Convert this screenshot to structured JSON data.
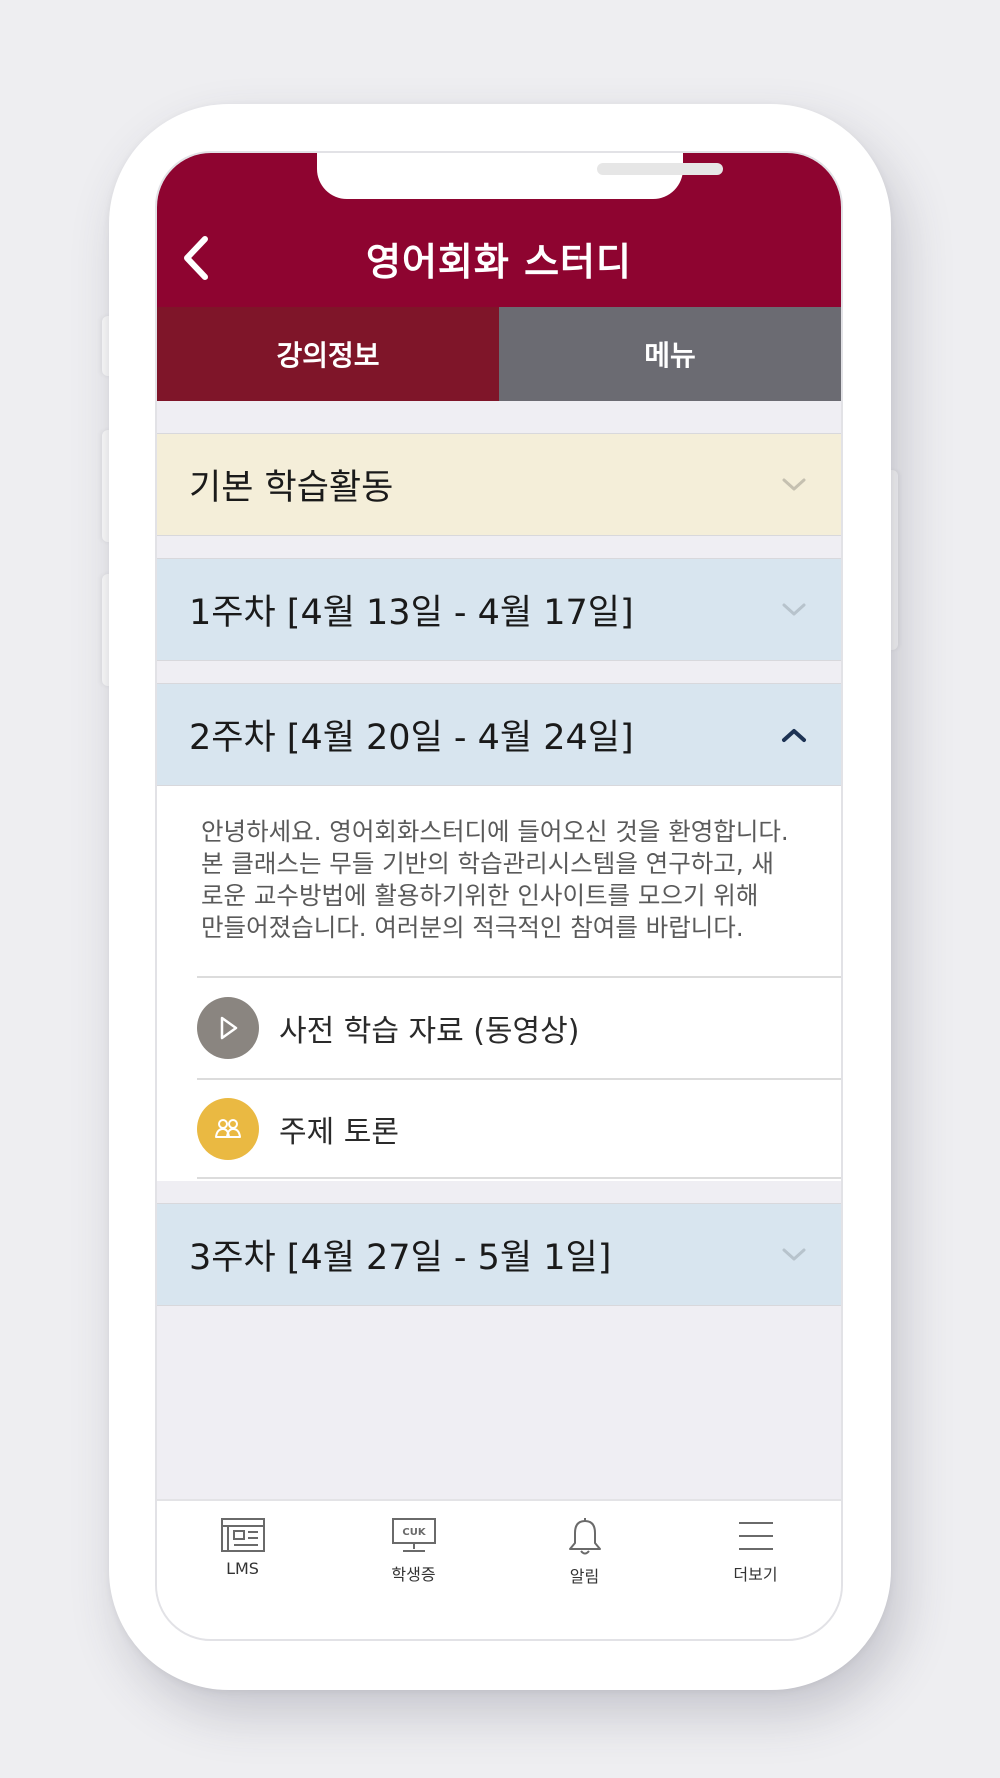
{
  "header": {
    "title": "영어회화 스터디",
    "back_icon": "chevron-left-icon"
  },
  "tabs": [
    {
      "label": "강의정보",
      "active": true
    },
    {
      "label": "메뉴",
      "active": false
    }
  ],
  "sections": {
    "basic": {
      "label": "기본 학습활동"
    },
    "week1": {
      "label": "1주차 [4월 13일 - 4월 17일]"
    },
    "week2": {
      "label": "2주차 [4월 20일 - 4월 24일]",
      "description_lines": [
        "안녕하세요. 영어회화스터디에 들어오신 것을 환영합니다.",
        "본 클래스는 무들 기반의 학습관리시스템을 연구하고, 새",
        "로운 교수방법에 활용하기위한 인사이트를 모으기 위해",
        "만들어졌습니다. 여러분의 적극적인 참여를 바랍니다."
      ],
      "items": [
        {
          "label": "사전 학습 자료 (동영상)",
          "icon": "play-icon",
          "color": "#8a8580"
        },
        {
          "label": "주제 토론",
          "icon": "people-icon",
          "color": "#eab942"
        }
      ]
    },
    "week3": {
      "label": "3주차 [4월 27일 - 5월 1일]"
    }
  },
  "bottom_nav": [
    {
      "label": "LMS",
      "icon": "lms-icon"
    },
    {
      "label": "학생증",
      "icon": "student-card-icon",
      "icon_text": "CUK"
    },
    {
      "label": "알림",
      "icon": "bell-icon"
    },
    {
      "label": "더보기",
      "icon": "menu-icon"
    }
  ],
  "colors": {
    "brand": "#8e0430",
    "tab_active": "#7f1529",
    "tab_inactive": "#6b6b72",
    "basic_section_bg": "#f4eed9",
    "week_section_bg": "#d8e5ef"
  }
}
